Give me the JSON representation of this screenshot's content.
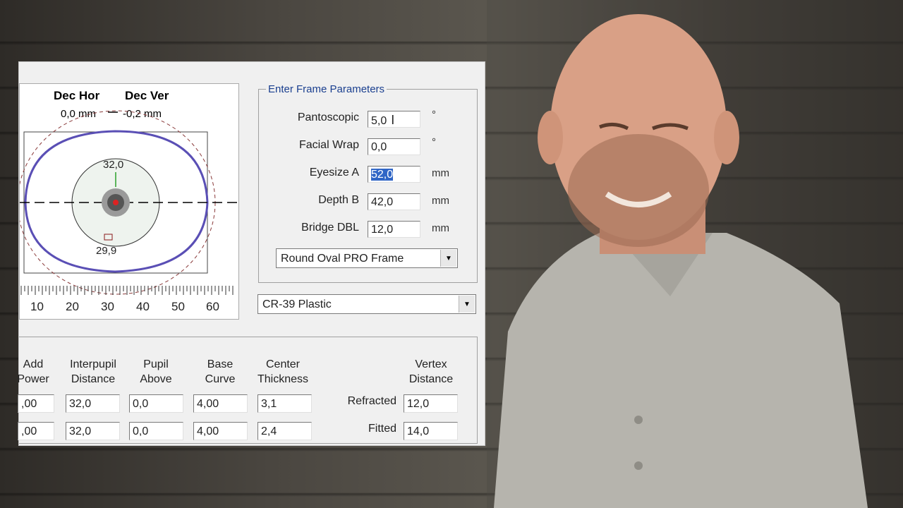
{
  "preview": {
    "dec_hor_label": "Dec Hor",
    "dec_ver_label": "Dec Ver",
    "dec_hor_value": "0,0 mm",
    "dec_ver_value": "-0,2 mm",
    "top_thickness": "32,0",
    "bottom_thickness": "29,9",
    "ruler_ticks": [
      "10",
      "20",
      "30",
      "40",
      "50",
      "60"
    ]
  },
  "frame_params": {
    "title": "Enter Frame Parameters",
    "rows": [
      {
        "label": "Pantoscopic",
        "value": "5,0",
        "unit": "°"
      },
      {
        "label": "Facial Wrap",
        "value": "0,0",
        "unit": "°"
      },
      {
        "label": "Eyesize A",
        "value": "52,0",
        "unit": "mm"
      },
      {
        "label": "Depth B",
        "value": "42,0",
        "unit": "mm"
      },
      {
        "label": "Bridge DBL",
        "value": "12,0",
        "unit": "mm"
      }
    ],
    "frame_select": "Round Oval PRO Frame"
  },
  "material_select": "CR-39 Plastic",
  "lens_table": {
    "headers": [
      {
        "line1": "Add",
        "line2": "Power"
      },
      {
        "line1": "Interpupil",
        "line2": "Distance"
      },
      {
        "line1": "Pupil",
        "line2": "Above"
      },
      {
        "line1": "Base",
        "line2": "Curve"
      },
      {
        "line1": "Center",
        "line2": "Thickness"
      }
    ],
    "rows": [
      [
        ",00",
        "32,0",
        "0,0",
        "4,00",
        "3,1"
      ],
      [
        ",00",
        "32,0",
        "0,0",
        "4,00",
        "2,4"
      ]
    ],
    "vertex_header": {
      "line1": "Vertex",
      "line2": "Distance"
    },
    "vertex_rows": [
      {
        "label": "Refracted",
        "value": "12,0"
      },
      {
        "label": "Fitted",
        "value": "14,0"
      }
    ]
  },
  "colors": {
    "lens_outline": "#5a4fb5",
    "selection": "#3066c6",
    "group_title": "#1a3f8f"
  }
}
